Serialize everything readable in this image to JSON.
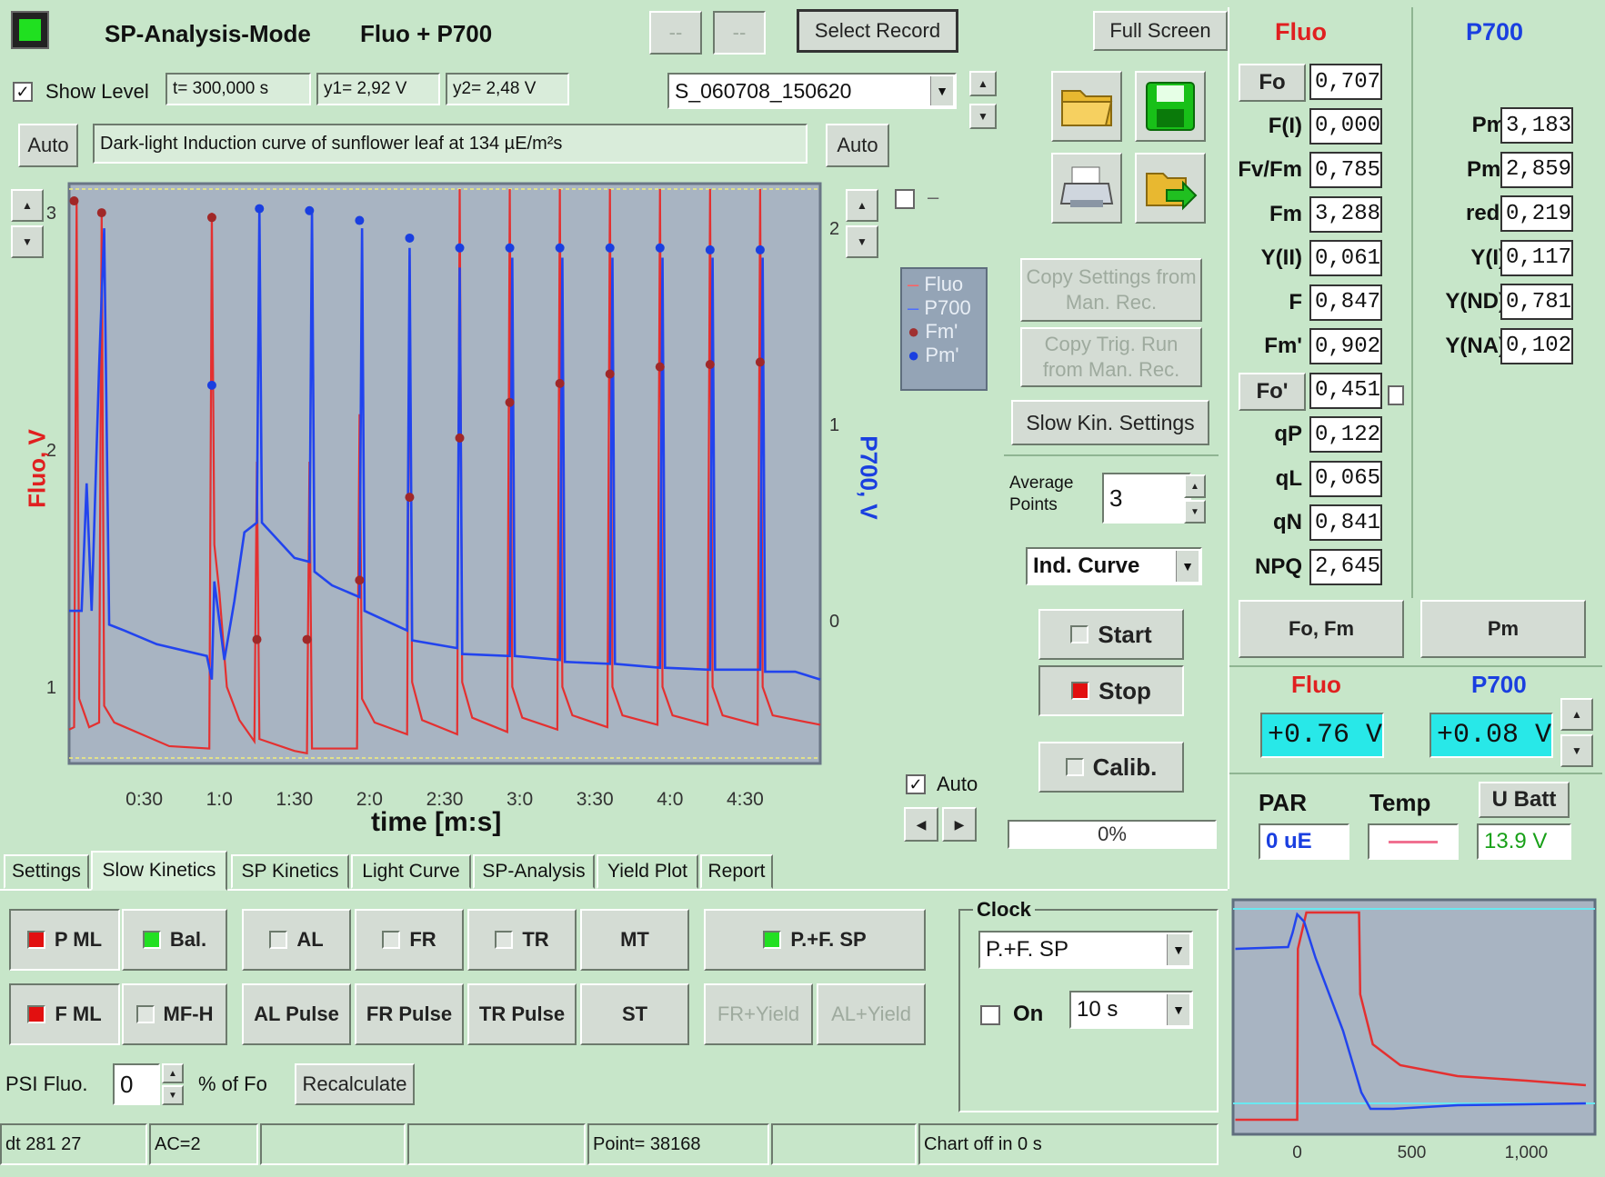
{
  "header": {
    "title": "SP-Analysis-Mode",
    "mode": "Fluo + P700",
    "btn_a": "--",
    "btn_b": "--",
    "select_record": "Select Record",
    "full_screen": "Full Screen"
  },
  "toolbar": {
    "show_level": "Show Level",
    "t_readout": "t= 300,000 s",
    "y1_readout": "y1= 2,92 V",
    "y2_readout": "y2= 2,48 V",
    "record_name": "S_060708_150620",
    "auto_left": "Auto",
    "auto_right": "Auto",
    "comment": "Dark-light Induction curve of sunflower leaf at 134 µE/m²s"
  },
  "chart_data": {
    "type": "line",
    "xlabel": "time [m:s]",
    "ylabel_left": "Fluo, V",
    "ylabel_right": "P700, V",
    "x_ticks": [
      "0:30",
      "1:0",
      "1:30",
      "2:0",
      "2:30",
      "3:0",
      "3:30",
      "4:0",
      "4:30"
    ],
    "x_tick_values": [
      30,
      60,
      90,
      120,
      150,
      180,
      210,
      240,
      270
    ],
    "y_left_ticks": [
      "1",
      "2",
      "3"
    ],
    "y_right_ticks": [
      "0",
      "1",
      "2"
    ],
    "xlim": [
      0,
      300
    ],
    "ylim_left": [
      0.7,
      3.1
    ],
    "ylim_right": [
      -0.7,
      2.2
    ],
    "legend": [
      "Fluo",
      "P700",
      "Fm'",
      "Pm'"
    ],
    "legend_position": "right",
    "colors": {
      "fluo": "#e02020",
      "p700": "#1a3fe0",
      "plot_bg": "#a8b4c2"
    },
    "fm_points": [
      [
        3,
        3.05
      ],
      [
        57,
        3.0
      ],
      [
        75,
        1.95
      ],
      [
        95,
        1.95
      ],
      [
        121,
        2.15
      ],
      [
        142,
        2.82
      ],
      [
        161,
        3.1
      ],
      [
        181,
        3.28
      ],
      [
        201,
        3.38
      ],
      [
        221,
        3.43
      ],
      [
        241,
        3.46
      ],
      [
        261,
        3.47
      ],
      [
        280,
        3.49
      ]
    ],
    "pm_points": [
      [
        57,
        2.3
      ],
      [
        76,
        3.35
      ],
      [
        96,
        3.35
      ],
      [
        116,
        3.22
      ],
      [
        136,
        3.12
      ],
      [
        156,
        3.05
      ],
      [
        176,
        3.03
      ],
      [
        196,
        3.04
      ],
      [
        216,
        3.04
      ],
      [
        236,
        3.05
      ],
      [
        256,
        3.04
      ],
      [
        276,
        3.04
      ]
    ],
    "fm_prime_markers": [
      [
        2,
        3.05
      ],
      [
        13,
        3.0
      ],
      [
        57,
        2.98
      ],
      [
        75,
        1.2
      ],
      [
        95,
        1.2
      ],
      [
        116,
        1.45
      ],
      [
        136,
        1.8
      ],
      [
        156,
        2.05
      ],
      [
        176,
        2.2
      ],
      [
        196,
        2.28
      ],
      [
        216,
        2.32
      ],
      [
        236,
        2.35
      ],
      [
        256,
        2.36
      ],
      [
        276,
        2.37
      ]
    ],
    "pm_prime_markers": [
      [
        57,
        1.2
      ],
      [
        76,
        2.1
      ],
      [
        96,
        2.09
      ],
      [
        116,
        2.04
      ],
      [
        136,
        1.95
      ],
      [
        156,
        1.9
      ],
      [
        176,
        1.9
      ],
      [
        196,
        1.9
      ],
      [
        216,
        1.9
      ],
      [
        236,
        1.9
      ],
      [
        256,
        1.89
      ],
      [
        276,
        1.89
      ]
    ]
  },
  "chart_controls": {
    "auto_checkbox": "Auto"
  },
  "mid_panel": {
    "copy_settings": "Copy Settings from Man. Rec.",
    "copy_trig": "Copy Trig. Run from Man. Rec.",
    "slow_kin": "Slow Kin. Settings",
    "avg_label": "Average Points",
    "avg_value": "3",
    "curve_select": "Ind. Curve",
    "start": "Start",
    "stop": "Stop",
    "calib": "Calib.",
    "progress": "0%"
  },
  "fluo_params": {
    "header": "Fluo",
    "rows": [
      {
        "name": "Fo",
        "value": "0,707"
      },
      {
        "name": "F(I)",
        "value": "0,000"
      },
      {
        "name": "Fv/Fm",
        "value": "0,785"
      },
      {
        "name": "Fm",
        "value": "3,288"
      },
      {
        "name": "Y(II)",
        "value": "0,061"
      },
      {
        "name": "F",
        "value": "0,847"
      },
      {
        "name": "Fm'",
        "value": "0,902"
      },
      {
        "name": "Fo'",
        "value": "0,451"
      },
      {
        "name": "qP",
        "value": "0,122"
      },
      {
        "name": "qL",
        "value": "0,065"
      },
      {
        "name": "qN",
        "value": "0,841"
      },
      {
        "name": "NPQ",
        "value": "2,645"
      }
    ]
  },
  "p700_params": {
    "header": "P700",
    "rows": [
      {
        "name": "Pm",
        "value": "3,183"
      },
      {
        "name": "Pm'",
        "value": "2,859"
      },
      {
        "name": "red.",
        "value": "0,219"
      },
      {
        "name": "Y(I)",
        "value": "0,117"
      },
      {
        "name": "Y(ND)",
        "value": "0,781"
      },
      {
        "name": "Y(NA)",
        "value": "0,102"
      }
    ]
  },
  "right_panel": {
    "fo_fm_btn": "Fo, Fm",
    "pm_btn": "Pm",
    "fluo_label": "Fluo",
    "p700_label": "P700",
    "fluo_reading": "+0.76 V",
    "p700_reading": "+0.08 V",
    "par_label": "PAR",
    "temp_label": "Temp",
    "ubatt_label": "U Batt",
    "par_value": "0 uE",
    "ubatt_value": "13.9 V"
  },
  "tabs": [
    "Settings",
    "Slow Kinetics",
    "SP Kinetics",
    "Light Curve",
    "SP-Analysis",
    "Yield Plot",
    "Report"
  ],
  "controls": {
    "pml": "P ML",
    "bal": "Bal.",
    "al": "AL",
    "fr": "FR",
    "tr": "TR",
    "mt": "MT",
    "pfsp": "P.+F. SP",
    "fml": "F ML",
    "mfh": "MF-H",
    "al_pulse": "AL Pulse",
    "fr_pulse": "FR Pulse",
    "tr_pulse": "TR Pulse",
    "st": "ST",
    "fr_yield": "FR+Yield",
    "al_yield": "AL+Yield",
    "psi_label": "PSI Fluo.",
    "psi_value": "0",
    "psi_unit": "% of Fo",
    "recalc": "Recalculate",
    "clock_label": "Clock",
    "clock_select": "P.+F. SP",
    "on_label": "On",
    "interval_select": "10 s"
  },
  "mini_chart": {
    "x_ticks": [
      "0",
      "500",
      "1,000"
    ],
    "xlim": [
      -280,
      1300
    ]
  },
  "status": {
    "s1": "dt 281 27",
    "s2": "AC=2",
    "s3": "Point= 38168",
    "s4": "Chart off in 0 s"
  }
}
